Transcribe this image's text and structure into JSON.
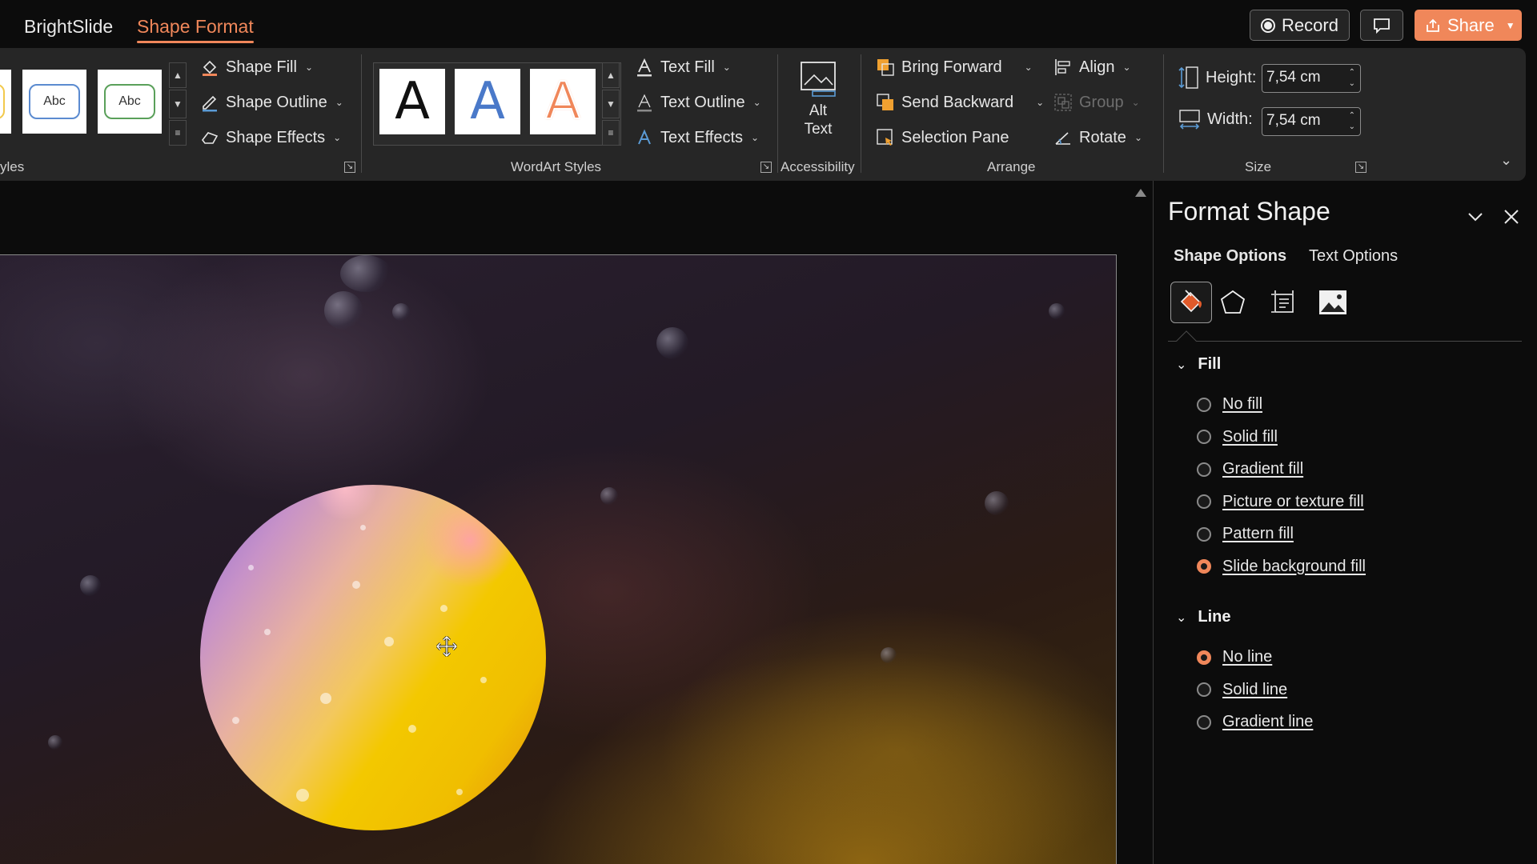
{
  "tabs": {
    "brightslide": "BrightSlide",
    "shape_format": "Shape Format"
  },
  "topbar": {
    "record_label": "Record",
    "share_label": "Share"
  },
  "ribbon": {
    "shape_styles": {
      "group_label_fragment": "yles",
      "style1_text": "Abc",
      "style2_text": "Abc",
      "shape_fill": "Shape Fill",
      "shape_outline": "Shape Outline",
      "shape_effects": "Shape Effects"
    },
    "wordart": {
      "group_label": "WordArt Styles",
      "letter": "A",
      "text_fill": "Text Fill",
      "text_outline": "Text Outline",
      "text_effects": "Text Effects"
    },
    "accessibility": {
      "group_label": "Accessibility",
      "alt_text_line1": "Alt",
      "alt_text_line2": "Text"
    },
    "arrange": {
      "group_label": "Arrange",
      "bring_forward": "Bring Forward",
      "send_backward": "Send Backward",
      "selection_pane": "Selection Pane",
      "align": "Align",
      "group": "Group",
      "rotate": "Rotate"
    },
    "size": {
      "group_label": "Size",
      "height_label": "Height:",
      "height_value": "7,54 cm",
      "width_label": "Width:",
      "width_value": "7,54 cm"
    }
  },
  "pane": {
    "title": "Format Shape",
    "tab_shape_options": "Shape Options",
    "tab_text_options": "Text Options",
    "fill_section": "Fill",
    "fill_options": [
      "No fill",
      "Solid fill",
      "Gradient fill",
      "Picture or texture fill",
      "Pattern fill",
      "Slide background fill"
    ],
    "fill_selected_index": 5,
    "line_section": "Line",
    "line_options": [
      "No line",
      "Solid line",
      "Gradient line"
    ],
    "line_selected_index": 0
  },
  "colors": {
    "accent": "#f0875a",
    "ribbon_bg": "#262626",
    "app_bg": "#0c0c0c",
    "wordart_blue": "#4a79c9",
    "wordart_orange": "#f0875a"
  },
  "icons": {
    "record": "record-dot-icon",
    "comment": "comment-icon",
    "share": "share-icon",
    "fill_line": "paint-bucket-icon",
    "effects": "pentagon-icon",
    "size_properties": "size-properties-icon",
    "picture": "picture-icon"
  }
}
